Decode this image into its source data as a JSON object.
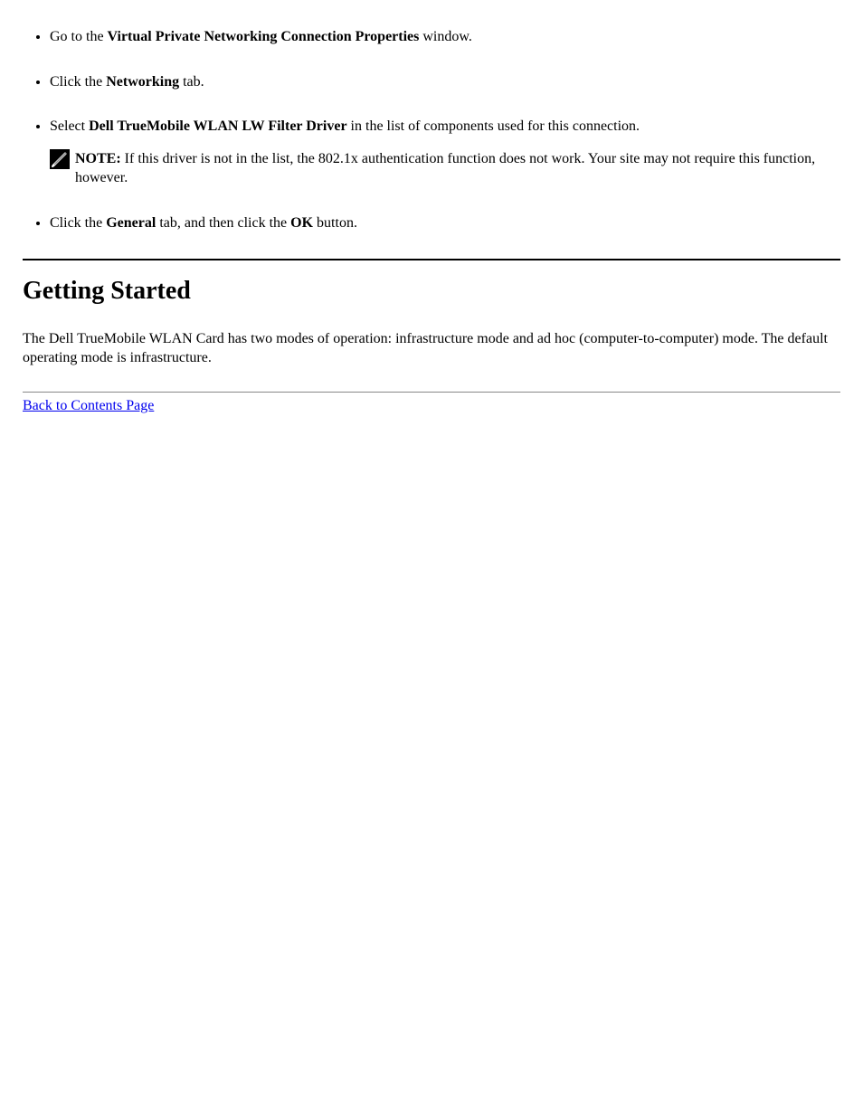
{
  "list": {
    "item1": {
      "prefix": "Go to the ",
      "bold": "Virtual Private Networking Connection Properties",
      "suffix": " window."
    },
    "item2": {
      "prefix": "Click the ",
      "bold": "Networking",
      "suffix": " tab."
    },
    "item3": {
      "prefix": "Select ",
      "bold": "Dell TrueMobile WLAN LW Filter Driver",
      "suffix": " in the list of components used for this connection.",
      "note_label": "NOTE: ",
      "note_text": "If this driver is not in the list, the 802.1x authentication function does not work. Your site may not require this function, however."
    },
    "item4": {
      "prefix": "Click the ",
      "bold1": "General",
      "mid": " tab, and then click the ",
      "bold2": "OK",
      "suffix": " button."
    }
  },
  "getting_started": {
    "heading": "Getting Started",
    "paragraph": "The Dell TrueMobile WLAN Card has two modes of operation: infrastructure mode and ad hoc (computer-to-computer) mode. The default operating mode is infrastructure."
  },
  "back_link": "Back to Contents Page"
}
